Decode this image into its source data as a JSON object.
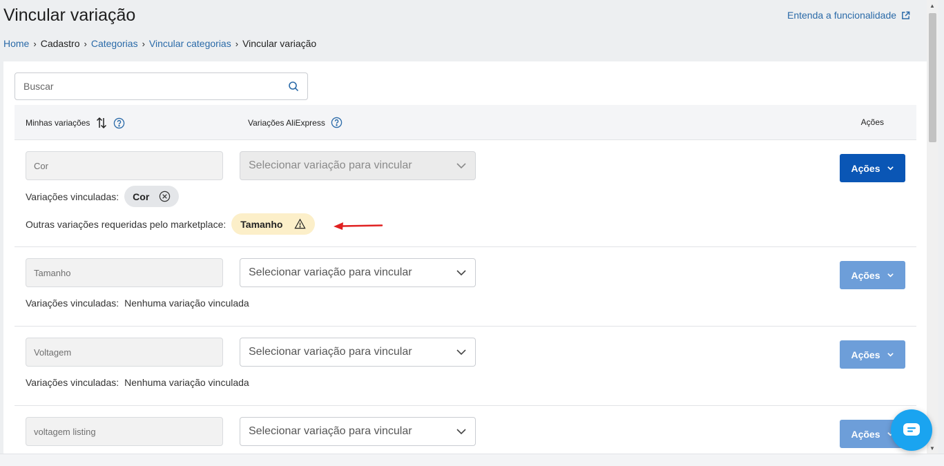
{
  "page": {
    "title": "Vincular variação",
    "help_link": "Entenda a funcionalidade"
  },
  "breadcrumb": {
    "home": "Home",
    "cadastro": "Cadastro",
    "categorias": "Categorias",
    "vincular_categorias": "Vincular categorias",
    "current": "Vincular variação"
  },
  "search": {
    "placeholder": "Buscar"
  },
  "table": {
    "col_minhas": "Minhas variações",
    "col_aliexpress": "Variações AliExpress",
    "col_acoes": "Ações"
  },
  "rows": [
    {
      "my_variation": "Cor",
      "select_placeholder": "Selecionar variação para vincular",
      "linked_label": "Variações vinculadas:",
      "linked_chip": "Cor",
      "required_label": "Outras variações requeridas pelo marketplace:",
      "required_chip": "Tamanho",
      "actions_label": "Ações"
    },
    {
      "my_variation": "Tamanho",
      "select_placeholder": "Selecionar variação para vincular",
      "linked_label": "Variações vinculadas:",
      "linked_value": "Nenhuma variação vinculada",
      "actions_label": "Ações"
    },
    {
      "my_variation": "Voltagem",
      "select_placeholder": "Selecionar variação para vincular",
      "linked_label": "Variações vinculadas:",
      "linked_value": "Nenhuma variação vinculada",
      "actions_label": "Ações"
    },
    {
      "my_variation": "voltagem listing",
      "select_placeholder": "Selecionar variação para vincular",
      "actions_label": "Ações"
    }
  ],
  "colors": {
    "primary": "#0a56b5",
    "primary_light": "#6d9ed9",
    "link": "#2a6aa8",
    "warning_chip": "#fcefc9",
    "annotation_arrow": "#e02020",
    "chat_button": "#1aa4f0"
  },
  "icons": {
    "help_link": "external-link-icon",
    "search": "search-icon",
    "sort": "sort-icon",
    "help": "question-circle-icon",
    "dropdown": "chevron-down-icon",
    "chip_remove": "close-circle-icon",
    "warning": "warning-triangle-icon",
    "chat": "chat-icon"
  }
}
